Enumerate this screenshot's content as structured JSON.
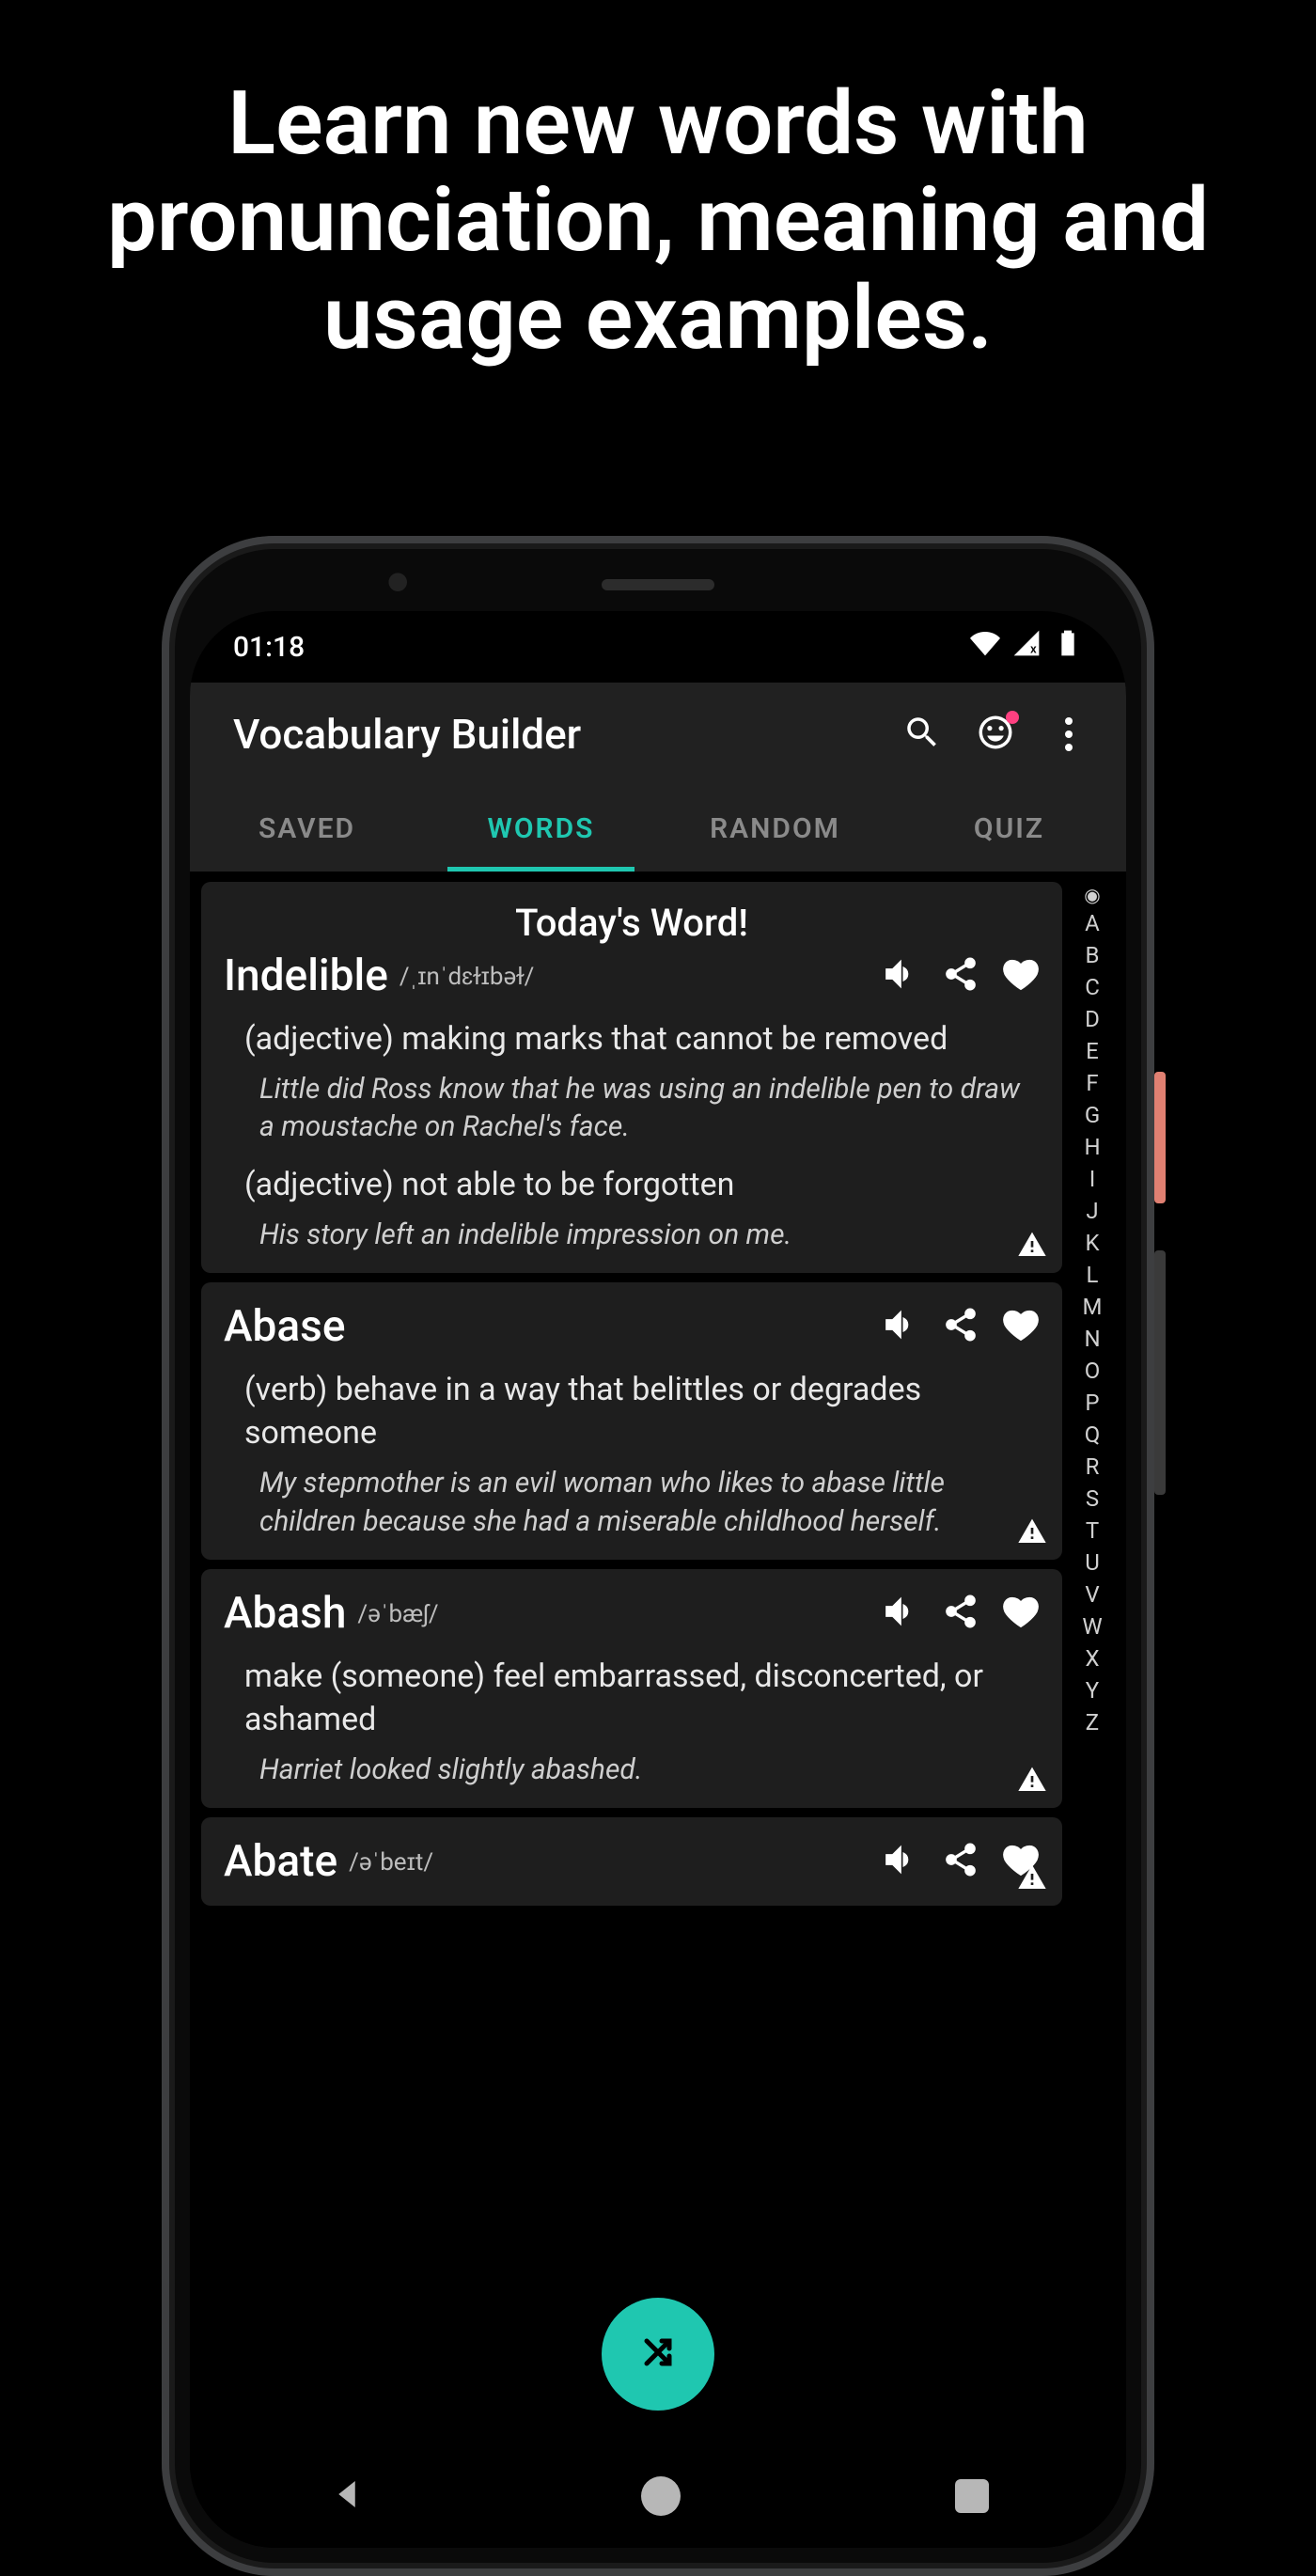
{
  "marketing_headline": "Learn new words with pronunciation, meaning and usage examples.",
  "status": {
    "time": "01:18"
  },
  "appbar": {
    "title": "Vocabulary Builder"
  },
  "tabs": {
    "items": [
      "SAVED",
      "WORDS",
      "RANDOM",
      "QUIZ"
    ],
    "active_index": 1
  },
  "today_label": "Today's Word!",
  "alpha_index": [
    "A",
    "B",
    "C",
    "D",
    "E",
    "F",
    "G",
    "H",
    "I",
    "J",
    "K",
    "L",
    "M",
    "N",
    "O",
    "P",
    "Q",
    "R",
    "S",
    "T",
    "U",
    "V",
    "W",
    "X",
    "Y",
    "Z"
  ],
  "words": [
    {
      "is_today": true,
      "word": "Indelible",
      "pronunciation": "/ˌɪnˈdɛɫɪbəɫ/",
      "senses": [
        {
          "definition": "(adjective) making marks that cannot be removed",
          "example": "Little did Ross know that he was using an indelible pen to draw a moustache on Rachel's face."
        },
        {
          "definition": "(adjective) not able to be forgotten",
          "example": "His story left an indelible impression on me."
        }
      ]
    },
    {
      "is_today": false,
      "word": "Abase",
      "pronunciation": "",
      "senses": [
        {
          "definition": "(verb) behave in a way that belittles or degrades someone",
          "example": "My stepmother is an evil woman who likes to abase little children because she had a miserable childhood herself."
        }
      ]
    },
    {
      "is_today": false,
      "word": "Abash",
      "pronunciation": "/əˈbæʃ/",
      "senses": [
        {
          "definition": "make (someone) feel embarrassed, disconcerted, or ashamed",
          "example": "Harriet looked slightly abashed."
        }
      ]
    },
    {
      "is_today": false,
      "word": "Abate",
      "pronunciation": "/əˈbeɪt/",
      "senses": []
    }
  ]
}
